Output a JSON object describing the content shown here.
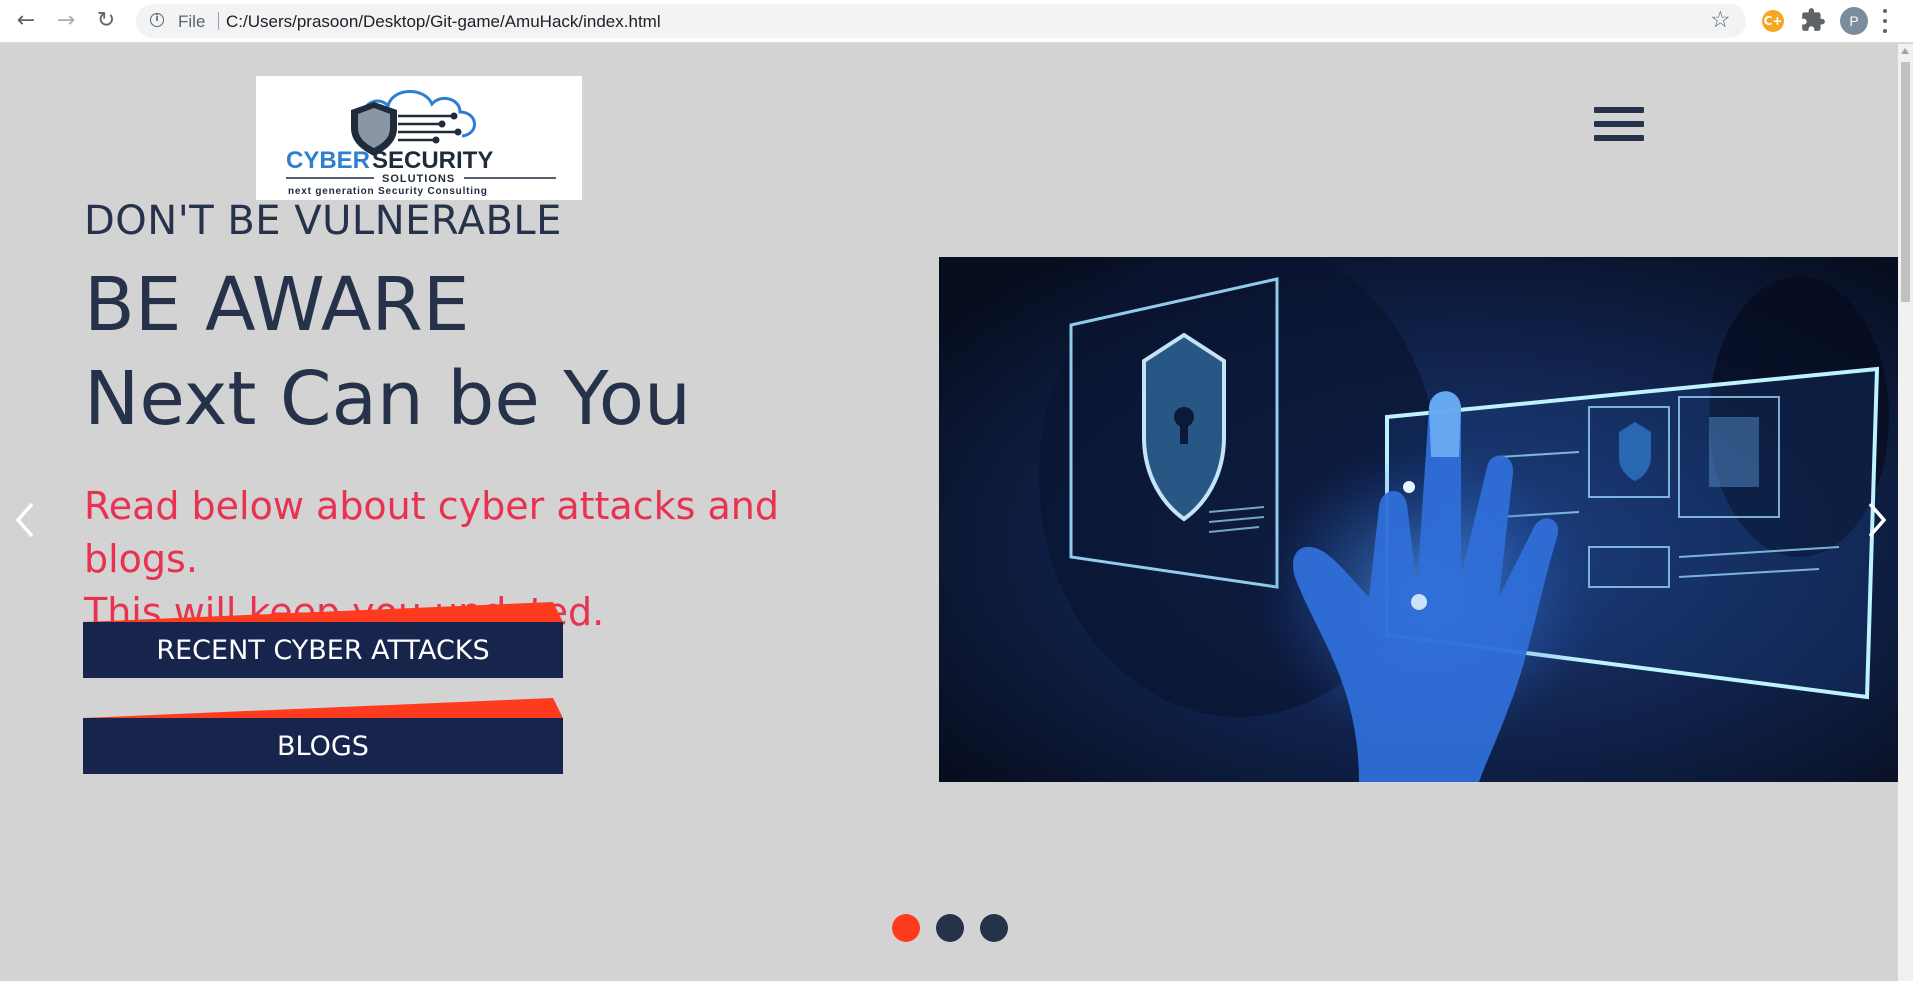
{
  "browser": {
    "file_label": "File",
    "url": "C:/Users/prasoon/Desktop/Git-game/AmuHack/index.html",
    "profile_initial": "P",
    "extension_label": "C+"
  },
  "logo": {
    "brand_cyber": "CYBER",
    "brand_security": "SECURITY",
    "brand_sub": "SOLUTIONS",
    "tagline": "next generation Security Consulting"
  },
  "hero": {
    "kicker": "DON'T BE VULNERABLE",
    "headline_1": "BE AWARE",
    "headline_2": "Next Can be You",
    "lede_1": "Read below about cyber attacks and blogs.",
    "lede_2": "This will keep you updated.",
    "cta_attacks": "RECENT CYBER ATTACKS",
    "cta_blogs": "BLOGS"
  },
  "carousel": {
    "active_index": 0,
    "slide_count": 3
  },
  "colors": {
    "background": "#d3d3d3",
    "heading": "#26324a",
    "lede": "#e8324f",
    "button_bg": "#17244c",
    "accent": "#ff3b1f",
    "dot_inactive": "#26324a",
    "dot_active": "#ff3b1f"
  }
}
